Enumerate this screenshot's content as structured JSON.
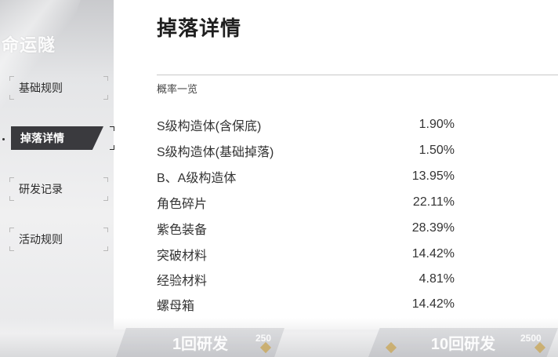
{
  "sidebar": {
    "title": "命运隧",
    "items": [
      {
        "label": "基础规则"
      },
      {
        "label": "掉落详情"
      },
      {
        "label": "研发记录"
      },
      {
        "label": "活动规则"
      }
    ]
  },
  "main": {
    "title": "掉落详情",
    "section_label": "概率一览",
    "rates": [
      {
        "name": "S级构造体(含保底)",
        "value": "1.90%"
      },
      {
        "name": "S级构造体(基础掉落)",
        "value": "1.50%"
      },
      {
        "name": "B、A级构造体",
        "value": "13.95%"
      },
      {
        "name": "角色碎片",
        "value": "22.11%"
      },
      {
        "name": "紫色装备",
        "value": "28.39%"
      },
      {
        "name": "突破材料",
        "value": "14.42%"
      },
      {
        "name": "经验材料",
        "value": "4.81%"
      },
      {
        "name": "螺母箱",
        "value": "14.42%"
      }
    ]
  },
  "footer": {
    "single_pull_label": "1回研发",
    "single_pull_cost": "250",
    "ten_pull_label": "10回研发",
    "ten_pull_cost": "2500"
  },
  "colors": {
    "active_nav_bg": "#3a3a3e",
    "panel_bg": "#ffffff",
    "sidebar_bg": "#e4e5e7"
  },
  "icons": {
    "cost_icon": "currency-icon",
    "active_marker": "dot-marker-icon"
  }
}
